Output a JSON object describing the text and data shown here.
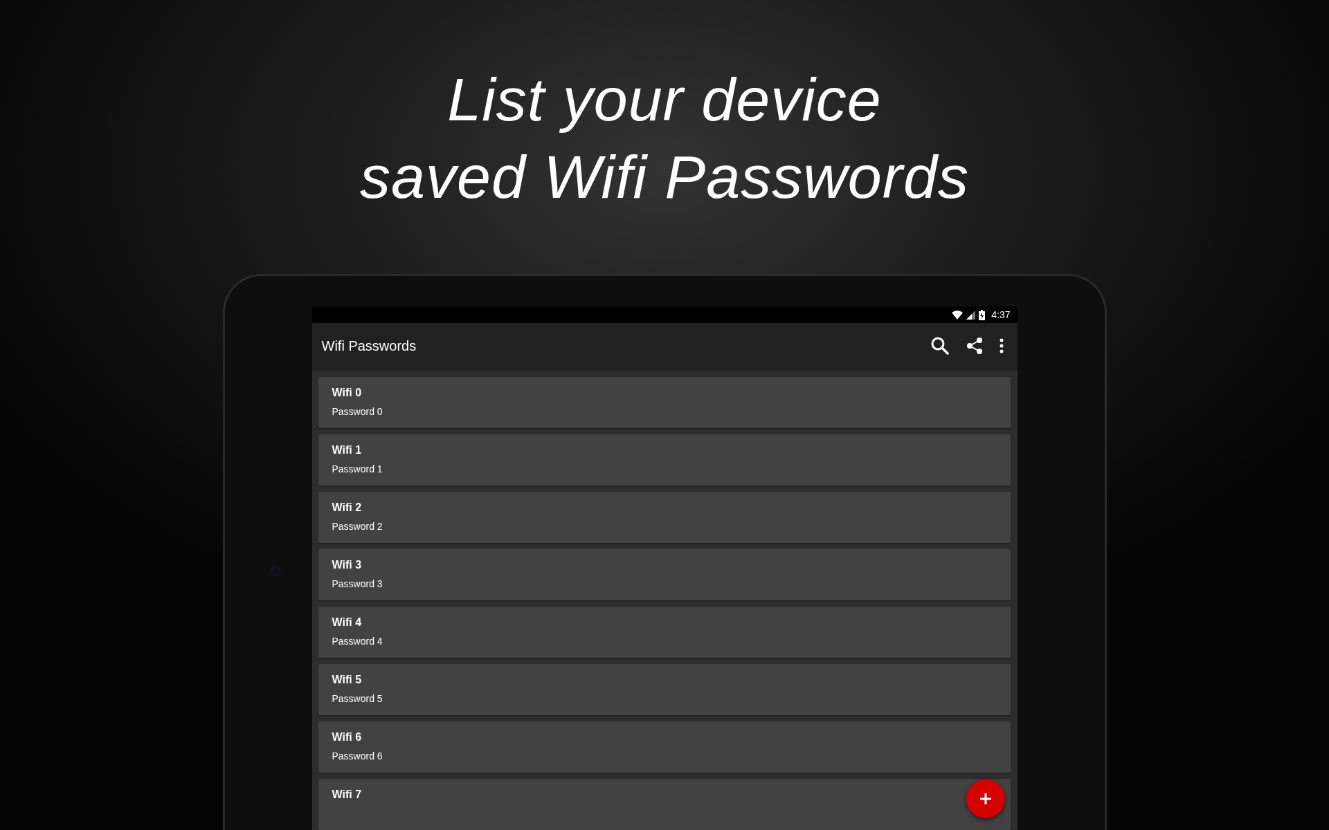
{
  "headline": [
    "List your device",
    "saved Wifi Passwords"
  ],
  "status_bar": {
    "time": "4:37"
  },
  "app_bar": {
    "title": "Wifi Passwords"
  },
  "networks": [
    {
      "name": "Wifi 0",
      "password": "Password 0"
    },
    {
      "name": "Wifi 1",
      "password": "Password 1"
    },
    {
      "name": "Wifi 2",
      "password": "Password 2"
    },
    {
      "name": "Wifi 3",
      "password": "Password 3"
    },
    {
      "name": "Wifi 4",
      "password": "Password 4"
    },
    {
      "name": "Wifi 5",
      "password": "Password 5"
    },
    {
      "name": "Wifi 6",
      "password": "Password 6"
    },
    {
      "name": "Wifi 7"
    }
  ]
}
